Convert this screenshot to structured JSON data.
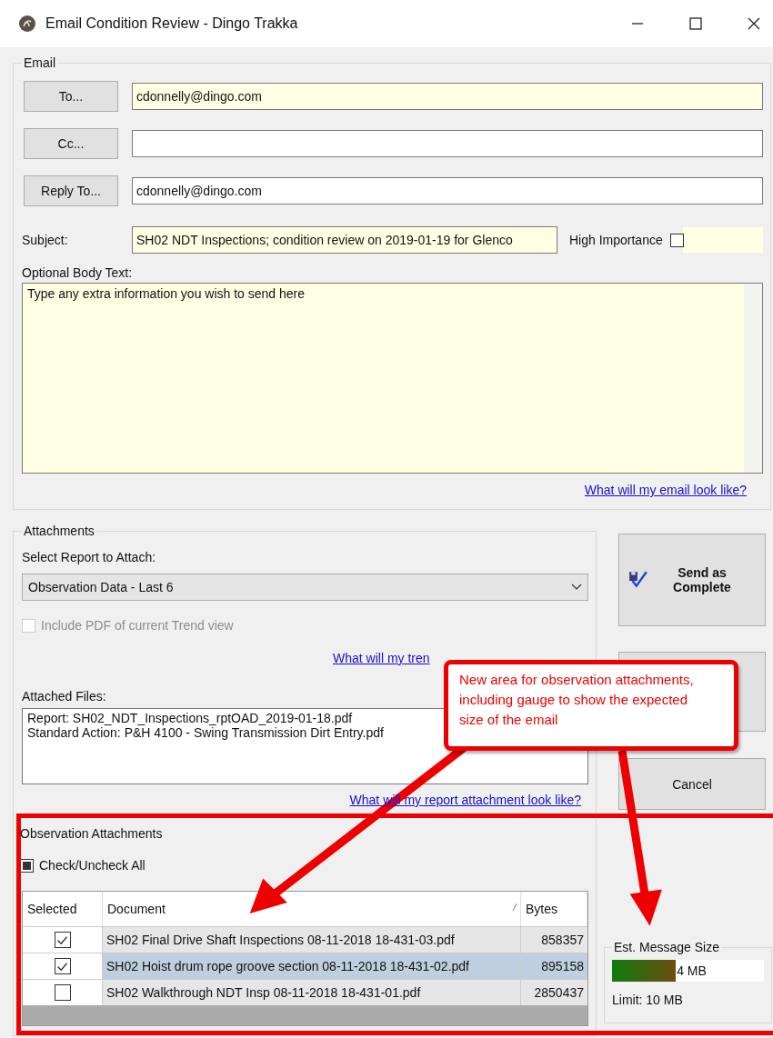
{
  "window": {
    "title": "Email Condition Review - Dingo Trakka"
  },
  "email": {
    "legend": "Email",
    "recipients": [
      {
        "button": "To...",
        "value": "cdonnelly@dingo.com",
        "required": true
      },
      {
        "button": "Cc...",
        "required": false
      },
      {
        "button": "Reply To...",
        "value": "cdonnelly@dingo.com",
        "required": false
      }
    ],
    "subject_label": "Subject:",
    "subject": "SH02 NDT Inspections; condition review on 2019-01-19 for Glenco",
    "high_importance": {
      "label": "High Importance",
      "checked": false
    },
    "body_label": "Optional Body Text:",
    "body": "Type any extra information you wish to send here",
    "preview_link": "What will my email look like?"
  },
  "attachments": {
    "legend": "Attachments",
    "select_label": "Select Report to Attach:",
    "report": "Observation Data - Last 6",
    "trend_pdf": {
      "label": "Include PDF of current Trend view",
      "checked": false,
      "disabled": true
    },
    "trend_link": "What will my tren",
    "files_label": "Attached Files:",
    "files": [
      "Report: SH02_NDT_Inspections_rptOAD_2019-01-18.pdf",
      "Standard Action: P&H 4100 - Swing Transmission Dirt Entry.pdf"
    ],
    "report_link": "What will my report attachment look like?"
  },
  "observation": {
    "legend": "Observation Attachments",
    "check_all": {
      "label": "Check/Uncheck All",
      "indeterminate": true
    },
    "columns": [
      "Selected",
      "Document",
      "Bytes"
    ],
    "rows": [
      {
        "checked": true,
        "selected": false,
        "document": "SH02 Final Drive Shaft Inspections 08-11-2018 18-431-03.pdf",
        "bytes": "858357"
      },
      {
        "checked": true,
        "selected": true,
        "document": "SH02 Hoist drum rope groove section 08-11-2018 18-431-02.pdf",
        "bytes": "895158"
      },
      {
        "checked": false,
        "selected": false,
        "document": "SH02 Walkthrough NDT Insp 08-11-2018 18-431-01.pdf",
        "bytes": "2850437"
      }
    ]
  },
  "actions": {
    "send": "Send as Complete",
    "cancel": "Cancel"
  },
  "size": {
    "legend": "Est. Message Size",
    "level": 0.42,
    "reading": "4 MB",
    "limit": "Limit: 10 MB"
  },
  "annotation": {
    "text": "New area for observation attachments, including gauge to show the expected size of the email"
  }
}
